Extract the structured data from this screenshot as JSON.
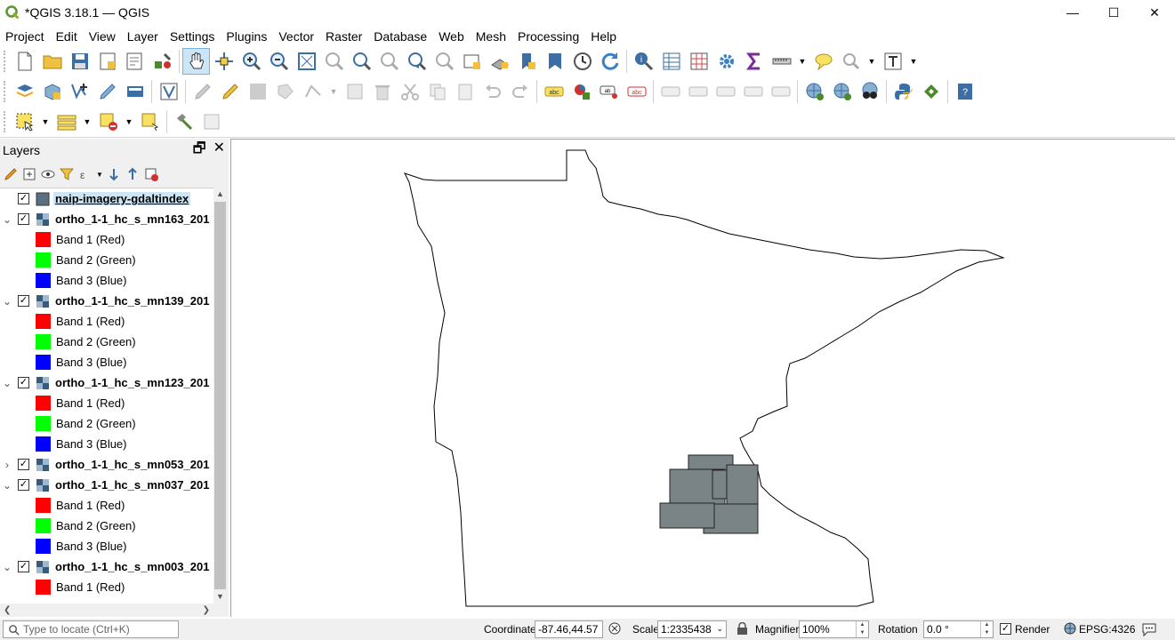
{
  "window": {
    "title": "*QGIS 3.18.1 — QGIS",
    "minimize": "—",
    "maximize": "☐",
    "close": "✕"
  },
  "menu": [
    "Project",
    "Edit",
    "View",
    "Layer",
    "Settings",
    "Plugins",
    "Vector",
    "Raster",
    "Database",
    "Web",
    "Mesh",
    "Processing",
    "Help"
  ],
  "layers_panel": {
    "title": "Layers",
    "float_btn": "🗗",
    "close_btn": "✕"
  },
  "layers": [
    {
      "name": "naip-imagery-gdaltindex",
      "type": "polygon",
      "checked": true,
      "selected": true,
      "expanded": null
    },
    {
      "name": "ortho_1-1_hc_s_mn163_201",
      "type": "raster",
      "checked": true,
      "expanded": true,
      "bands": [
        "Band 1 (Red)",
        "Band 2 (Green)",
        "Band 3 (Blue)"
      ]
    },
    {
      "name": "ortho_1-1_hc_s_mn139_201",
      "type": "raster",
      "checked": true,
      "expanded": true,
      "bands": [
        "Band 1 (Red)",
        "Band 2 (Green)",
        "Band 3 (Blue)"
      ]
    },
    {
      "name": "ortho_1-1_hc_s_mn123_201",
      "type": "raster",
      "checked": true,
      "expanded": true,
      "bands": [
        "Band 1 (Red)",
        "Band 2 (Green)",
        "Band 3 (Blue)"
      ]
    },
    {
      "name": "ortho_1-1_hc_s_mn053_201",
      "type": "raster",
      "checked": true,
      "expanded": false,
      "bands": []
    },
    {
      "name": "ortho_1-1_hc_s_mn037_201",
      "type": "raster",
      "checked": true,
      "expanded": true,
      "bands": [
        "Band 1 (Red)",
        "Band 2 (Green)",
        "Band 3 (Blue)"
      ]
    },
    {
      "name": "ortho_1-1_hc_s_mn003_201",
      "type": "raster",
      "checked": true,
      "expanded": true,
      "bands": [
        "Band 1 (Red)"
      ]
    }
  ],
  "band_colors": {
    "Red": "#ff0000",
    "Green": "#00ff00",
    "Blue": "#0000ff"
  },
  "colors": {
    "footprint_fill": "#7a8487",
    "boundary_stroke": "#000000",
    "selection": "#cde6f7"
  },
  "statusbar": {
    "locator_placeholder": "Type to locate (Ctrl+K)",
    "coordinate_label": "Coordinate",
    "coordinate_value": "-87.46,44.57",
    "scale_label": "Scale",
    "scale_value": "1:2335438",
    "magnifier_label": "Magnifier",
    "magnifier_value": "100%",
    "rotation_label": "Rotation",
    "rotation_value": "0.0 °",
    "render_label": "Render",
    "render_checked": true,
    "crs": "EPSG:4326"
  }
}
